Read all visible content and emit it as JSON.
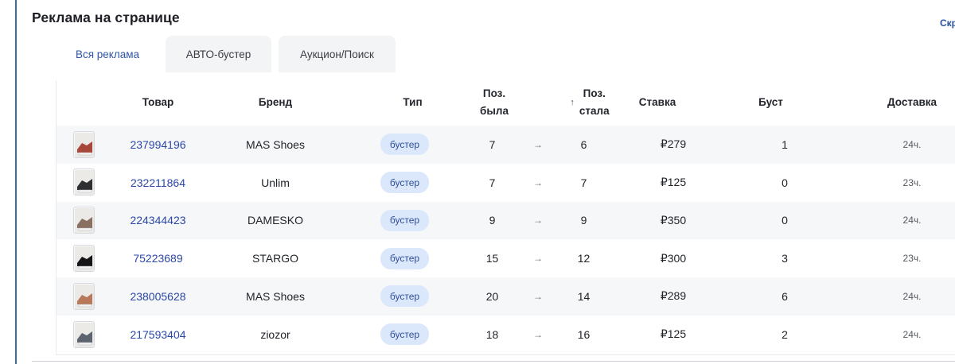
{
  "section": {
    "title": "Реклама на странице",
    "hide_link": "Скрыть"
  },
  "tabs": [
    {
      "label": "Вся реклама",
      "active": true
    },
    {
      "label": "АВТО-бустер",
      "active": false
    },
    {
      "label": "Аукцион/Поиск",
      "active": false
    }
  ],
  "table": {
    "columns": {
      "product": "Товар",
      "brand": "Бренд",
      "type": "Тип",
      "pos_was_1": "Поз.",
      "pos_was_2": "была",
      "pos_now_1": "Поз.",
      "pos_now_2": "стала",
      "bid": "Ставка",
      "boost": "Буст",
      "delivery": "Доставка"
    },
    "sort_icon": "sort-asc-icon",
    "arrow_icon": "arrow-right-icon",
    "rows": [
      {
        "id": "237994196",
        "brand": "MAS Shoes",
        "type": "бустер",
        "was": "7",
        "now": "6",
        "bid": "₽279",
        "boost": "1",
        "delivery": "24ч.",
        "thumb_color": "#a8463a"
      },
      {
        "id": "232211864",
        "brand": "Unlim",
        "type": "бустер",
        "was": "7",
        "now": "7",
        "bid": "₽125",
        "boost": "0",
        "delivery": "23ч.",
        "thumb_color": "#2e2f33"
      },
      {
        "id": "224344423",
        "brand": "DAMESKO",
        "type": "бустер",
        "was": "9",
        "now": "9",
        "bid": "₽350",
        "boost": "0",
        "delivery": "24ч.",
        "thumb_color": "#8a6f63"
      },
      {
        "id": "75223689",
        "brand": "STARGO",
        "type": "бустер",
        "was": "15",
        "now": "12",
        "bid": "₽300",
        "boost": "3",
        "delivery": "23ч.",
        "thumb_color": "#151517"
      },
      {
        "id": "238005628",
        "brand": "MAS Shoes",
        "type": "бустер",
        "was": "20",
        "now": "14",
        "bid": "₽289",
        "boost": "6",
        "delivery": "24ч.",
        "thumb_color": "#b8795a"
      },
      {
        "id": "217593404",
        "brand": "ziozor",
        "type": "бустер",
        "was": "18",
        "now": "16",
        "bid": "₽125",
        "boost": "2",
        "delivery": "24ч.",
        "thumb_color": "#5d6470"
      }
    ]
  }
}
